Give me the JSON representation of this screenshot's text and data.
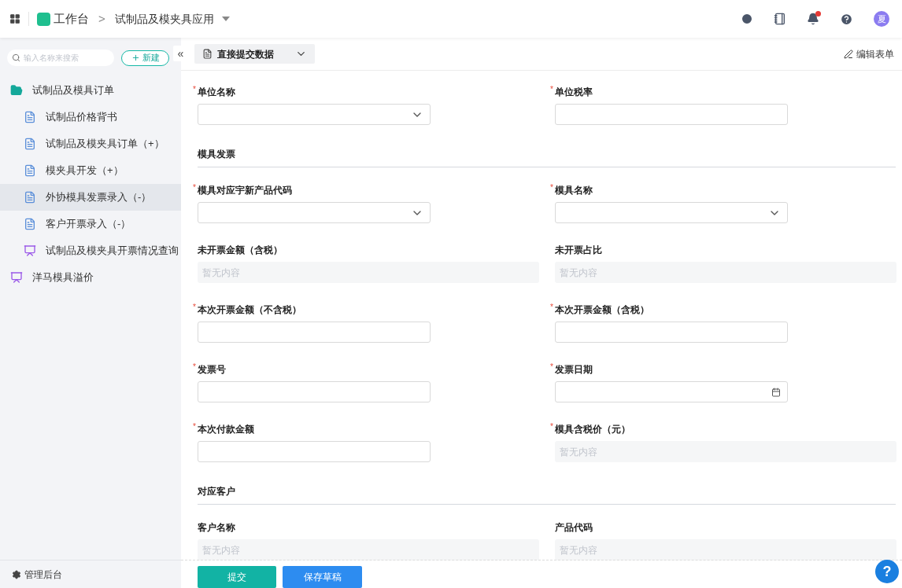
{
  "header": {
    "home": "工作台",
    "separator": ">",
    "app_title": "试制品及模夹具应用",
    "avatar": "夏",
    "notification_dot": true
  },
  "sidebar": {
    "search": {
      "placeholder": "输入名称来搜索"
    },
    "new_button": "新建",
    "collapse": "«",
    "items": [
      {
        "label": "试制品及模具订单",
        "kind": "folder",
        "selected": false,
        "children": [
          {
            "label": "试制品价格背书",
            "kind": "form",
            "selected": false
          },
          {
            "label": "试制品及模夹具订单（+）",
            "kind": "form",
            "selected": false
          },
          {
            "label": "模夹具开发（+）",
            "kind": "form",
            "selected": false
          },
          {
            "label": "外协模具发票录入（-）",
            "kind": "form",
            "selected": true
          },
          {
            "label": "客户开票录入（-）",
            "kind": "form",
            "selected": false
          },
          {
            "label": "试制品及模夹具开票情况查询",
            "kind": "report",
            "selected": false
          }
        ]
      },
      {
        "label": "洋马模具溢价",
        "kind": "report",
        "selected": false
      }
    ],
    "footer": "管理后台"
  },
  "toolbar": {
    "mode": "直接提交数据",
    "edit": "编辑表单"
  },
  "form": [
    {
      "kind": "row",
      "fields": [
        {
          "label": "单位名称",
          "marker": "*",
          "kind": "select"
        },
        {
          "label": "单位税率",
          "marker": "*",
          "kind": "text"
        }
      ]
    },
    {
      "kind": "section",
      "title": "模具发票"
    },
    {
      "kind": "row",
      "fields": [
        {
          "label": "模具对应宇新产品代码",
          "marker": "*",
          "kind": "select"
        },
        {
          "label": "模具名称",
          "marker": "*",
          "kind": "select"
        }
      ]
    },
    {
      "kind": "row",
      "fields": [
        {
          "label": "未开票金额（含税）",
          "kind": "readonly",
          "placeholder": "暂无内容"
        },
        {
          "label": "未开票占比",
          "kind": "readonly",
          "placeholder": "暂无内容"
        }
      ]
    },
    {
      "kind": "row",
      "fields": [
        {
          "label": "本次开票金额（不含税）",
          "marker": "*",
          "kind": "text"
        },
        {
          "label": "本次开票金额（含税）",
          "marker": "*",
          "kind": "text"
        }
      ]
    },
    {
      "kind": "row",
      "fields": [
        {
          "label": "发票号",
          "marker": "*",
          "kind": "text"
        },
        {
          "label": "发票日期",
          "marker": "*",
          "kind": "date"
        }
      ]
    },
    {
      "kind": "row",
      "fields": [
        {
          "label": "本次付款金额",
          "marker": "*",
          "kind": "text"
        },
        {
          "label": "模具含税价（元）",
          "marker": "*",
          "kind": "readonly",
          "placeholder": "暂无内容"
        }
      ]
    },
    {
      "kind": "section",
      "title": "对应客户"
    },
    {
      "kind": "row",
      "fields": [
        {
          "label": "客户名称",
          "kind": "readonly",
          "placeholder": "暂无内容"
        },
        {
          "label": "产品代码",
          "kind": "readonly",
          "placeholder": "暂无内容"
        }
      ]
    }
  ],
  "actions": {
    "submit": "提交",
    "draft": "保存草稿",
    "help": "?"
  }
}
